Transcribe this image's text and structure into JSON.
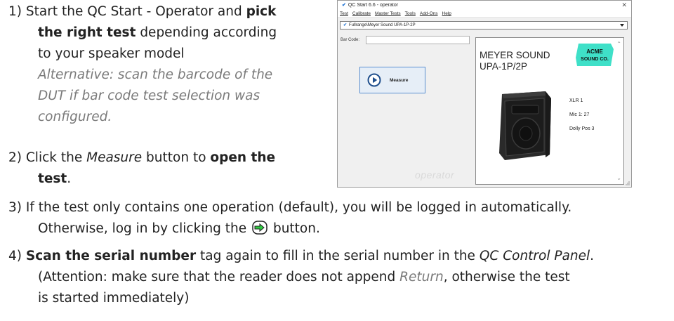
{
  "steps": {
    "s1": {
      "num": "1)",
      "pre": "Start the QC Start - Operator and",
      "bold1": "pick",
      "bold2": "the right test",
      "mid": "depending according",
      "line3": "to your speaker model",
      "alt1": "Alternative: scan the barcode of the",
      "alt2": "DUT if bar code test selection was",
      "alt3": "configured."
    },
    "s2": {
      "num": "2)",
      "pre": "Click the",
      "ital": "Measure",
      "mid": "button to",
      "bold1": "open the",
      "bold2": "test",
      "end": "."
    },
    "s3": {
      "num": "3)",
      "line1": "If the test only contains one operation (default), you will be logged in automatically.",
      "line2pre": "Otherwise, log in by clicking the",
      "line2post": "button."
    },
    "s4": {
      "num": "4)",
      "bold": "Scan the serial number",
      "pre": "tag again to fill in the serial number in the",
      "ital": "QC Control Panel",
      "end": ".",
      "line2pre": "(Attention: make sure that the reader does not append",
      "line2ital": "Return",
      "line2post": ", otherwise the test",
      "line3": "is started immediately)"
    }
  },
  "app": {
    "title": "QC Start 6.6 - operator",
    "menu": [
      "Test",
      "Calibrate",
      "Master Tests",
      "Tools",
      "Add-Ons",
      "Help"
    ],
    "selected_test": "Fullrange\\Meyer Sound UPA-1P-2P",
    "barcode_label": "Bar Code:",
    "barcode_value": "",
    "measure_label": "Measure",
    "watermark": "operator",
    "panel": {
      "title": "MEYER SOUND UPA-1P/2P",
      "logo_line1": "ACME",
      "logo_line2": "SOUND CO.",
      "info": [
        "XLR 1",
        "Mic 1: 27",
        "Dolly Pos 3"
      ]
    }
  },
  "colors": {
    "accent": "#1a6fd1",
    "logo_bg": "#3fe0c8",
    "alt_text": "#7a7a7a",
    "login_icon": "#2ecc40"
  }
}
